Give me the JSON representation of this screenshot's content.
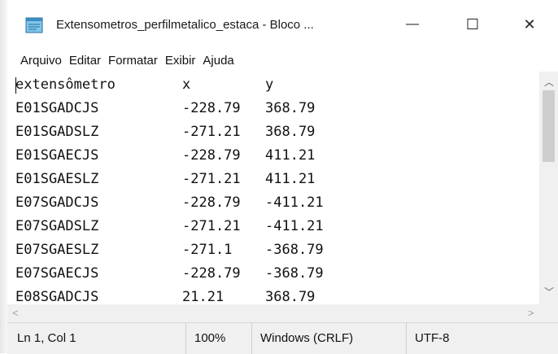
{
  "window": {
    "title": "Extensometros_perfilmetalico_estaca - Bloco ...",
    "controls": {
      "minimize": "—",
      "maximize": "☐",
      "close": "✕"
    }
  },
  "menu": [
    "Arquivo",
    "Editar",
    "Formatar",
    "Exibir",
    "Ajuda"
  ],
  "document": {
    "rows": [
      [
        "extensômetro",
        "x",
        "y"
      ],
      [
        "E01SGADCJS",
        "-228.79",
        "368.79"
      ],
      [
        "E01SGADSLZ",
        "-271.21",
        "368.79"
      ],
      [
        "E01SGAECJS",
        "-228.79",
        "411.21"
      ],
      [
        "E01SGAESLZ",
        "-271.21",
        "411.21"
      ],
      [
        "E07SGADCJS",
        "-228.79",
        "-411.21"
      ],
      [
        "E07SGADSLZ",
        "-271.21",
        "-411.21"
      ],
      [
        "E07SGAESLZ",
        "-271.1",
        "-368.79"
      ],
      [
        "E07SGAECJS",
        "-228.79",
        "-368.79"
      ],
      [
        "E08SGADCJS",
        "21.21",
        "368.79"
      ]
    ]
  },
  "status": {
    "position": "Ln 1, Col 1",
    "zoom": "100%",
    "line_ending": "Windows (CRLF)",
    "encoding": "UTF-8"
  }
}
